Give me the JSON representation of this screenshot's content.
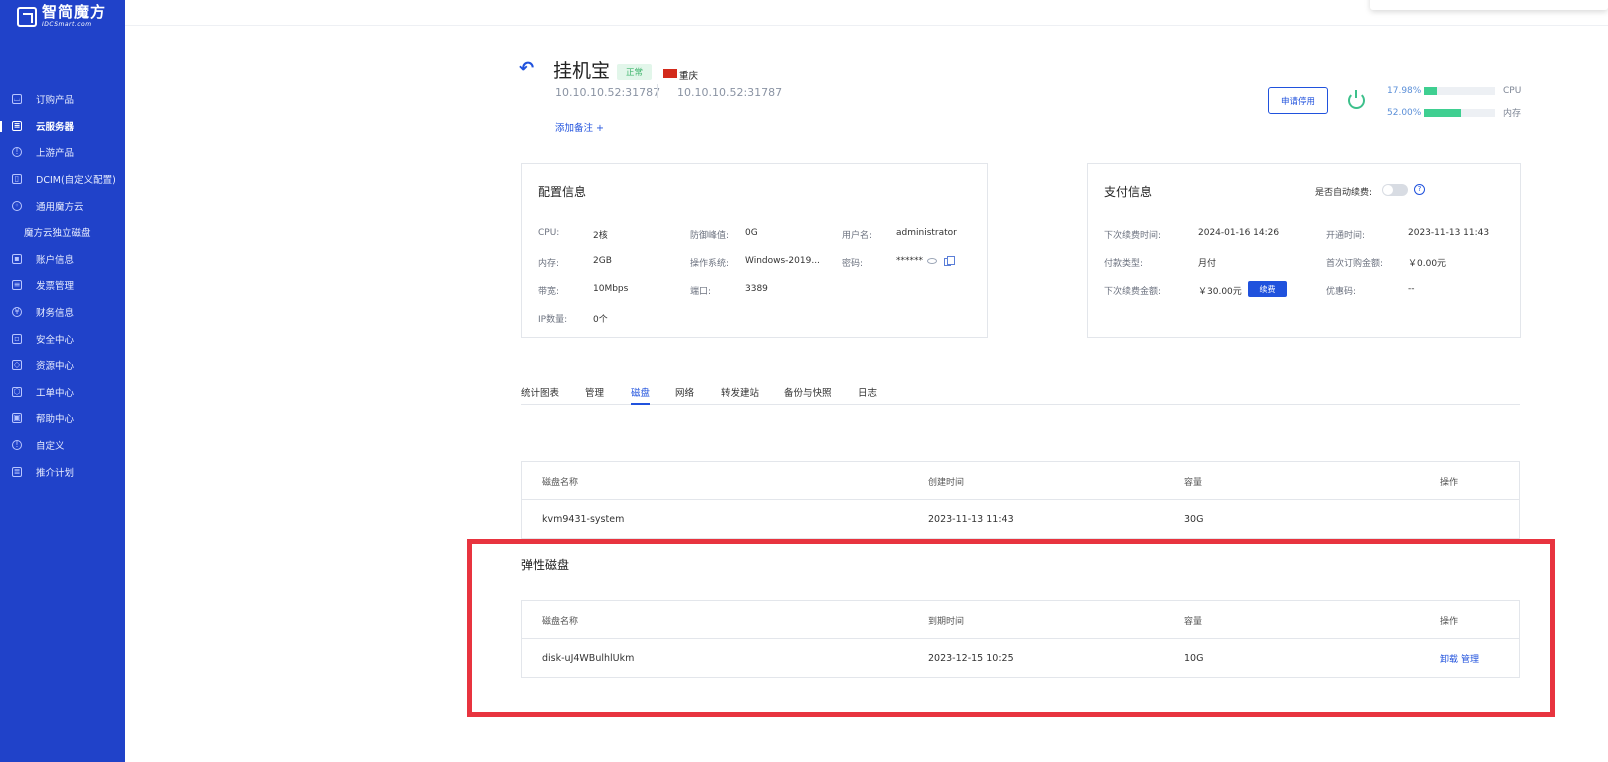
{
  "brand": {
    "name": "智简魔方",
    "sub": "IDCSmart.com"
  },
  "sidebar": {
    "items": [
      {
        "label": "订购产品",
        "icon": "cart-icon"
      },
      {
        "label": "云服务器",
        "icon": "database-icon",
        "active": true
      },
      {
        "label": "上游产品",
        "icon": "info-icon"
      },
      {
        "label": "DCIM(自定义配置)",
        "icon": "bookmark-icon"
      },
      {
        "label": "通用魔方云",
        "icon": "globe-icon"
      },
      {
        "label": "魔方云独立磁盘",
        "sub": true
      },
      {
        "label": "账户信息",
        "icon": "user-card-icon"
      },
      {
        "label": "发票管理",
        "icon": "invoice-icon"
      },
      {
        "label": "财务信息",
        "icon": "finance-icon"
      },
      {
        "label": "安全中心",
        "icon": "lock-icon"
      },
      {
        "label": "资源中心",
        "icon": "tag-icon"
      },
      {
        "label": "工单中心",
        "icon": "box-icon"
      },
      {
        "label": "帮助中心",
        "icon": "help-book-icon"
      },
      {
        "label": "自定义",
        "icon": "info-circle-icon"
      },
      {
        "label": "推介计划",
        "icon": "doc-icon"
      }
    ]
  },
  "header": {
    "title": "挂机宝",
    "status": "正常",
    "region": "重庆",
    "ip1": "10.10.10.52:31787",
    "ip2": "10.10.10.52:31787",
    "add_note": "添加备注 +",
    "apply_stop": "申请停用",
    "cpu": {
      "pct_text": "17.98%",
      "label": "CPU",
      "value": 17.98
    },
    "mem": {
      "pct_text": "52.00%",
      "label": "内存",
      "value": 52.0
    }
  },
  "config": {
    "title": "配置信息",
    "rows": {
      "cpu_label": "CPU:",
      "cpu_value": "2核",
      "defense_label": "防御峰值:",
      "defense_value": "0G",
      "user_label": "用户名:",
      "user_value": "administrator",
      "mem_label": "内存:",
      "mem_value": "2GB",
      "os_label": "操作系统:",
      "os_value": "Windows-2019...",
      "pwd_label": "密码:",
      "pwd_value": "******",
      "bw_label": "带宽:",
      "bw_value": "10Mbps",
      "port_label": "端口:",
      "port_value": "3389",
      "ip_label": "IP数量:",
      "ip_value": "0个"
    }
  },
  "payment": {
    "title": "支付信息",
    "auto_renew_label": "是否自动续费:",
    "auto_renew_on": false,
    "rows": {
      "next_renew_label": "下次续费时间:",
      "next_renew_value": "2024-01-16 14:26",
      "open_label": "开通时间:",
      "open_value": "2023-11-13 11:43",
      "pay_type_label": "付款类型:",
      "pay_type_value": "月付",
      "first_amount_label": "首次订购金额:",
      "first_amount_value": "￥0.00元",
      "next_amount_label": "下次续费金额:",
      "next_amount_value": "￥30.00元",
      "renew_btn": "续费",
      "coupon_label": "优惠码:",
      "coupon_value": "--"
    }
  },
  "tabs": [
    "统计图表",
    "管理",
    "磁盘",
    "网络",
    "转发建站",
    "备份与快照",
    "日志"
  ],
  "active_tab": "磁盘",
  "system_disk": {
    "headers": {
      "name": "磁盘名称",
      "time": "创建时间",
      "size": "容量",
      "ops": "操作"
    },
    "rows": [
      {
        "name": "kvm9431-system",
        "time": "2023-11-13 11:43",
        "size": "30G"
      }
    ]
  },
  "elastic_disk": {
    "title": "弹性磁盘",
    "headers": {
      "name": "磁盘名称",
      "time": "到期时间",
      "size": "容量",
      "ops": "操作"
    },
    "rows": [
      {
        "name": "disk-uJ4WBulhlUkm",
        "time": "2023-12-15 10:25",
        "size": "10G",
        "op1": "卸载",
        "op2": "管理"
      }
    ]
  },
  "colors": {
    "sidebar": "#2042c9",
    "accent": "#2052dd",
    "highlight": "#e8343f",
    "usage": "#3fcf91"
  }
}
